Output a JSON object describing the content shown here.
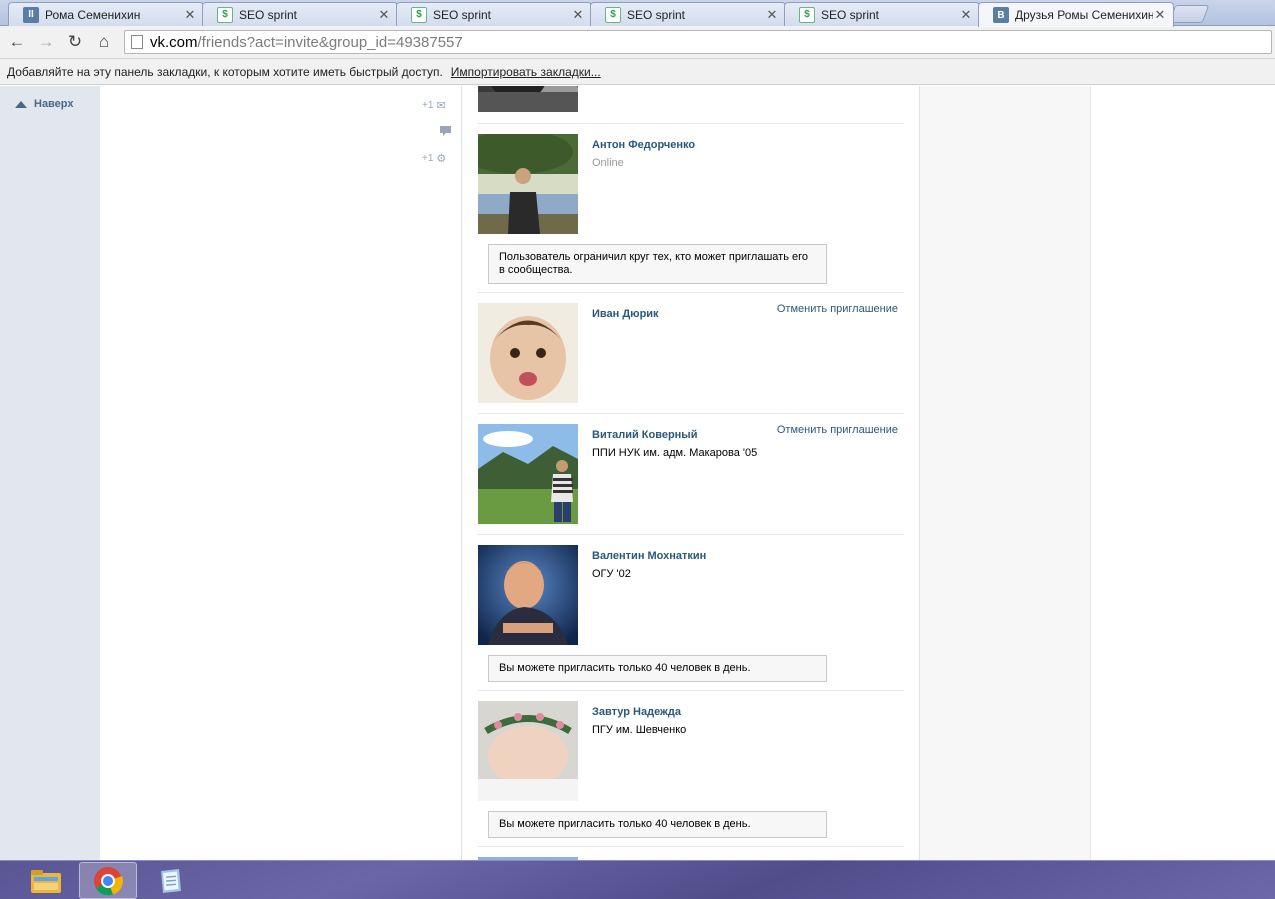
{
  "browser": {
    "tabs": [
      {
        "label": "Рома Семенихин",
        "favicon": "vk-pause-icon",
        "active": false
      },
      {
        "label": "SEO sprint",
        "favicon": "seo-sprint-icon",
        "active": false
      },
      {
        "label": "SEO sprint",
        "favicon": "seo-sprint-icon",
        "active": false
      },
      {
        "label": "SEO sprint",
        "favicon": "seo-sprint-icon",
        "active": false
      },
      {
        "label": "SEO sprint",
        "favicon": "seo-sprint-icon",
        "active": false
      },
      {
        "label": "Друзья Ромы Семенихина",
        "favicon": "vk-icon",
        "active": true
      }
    ],
    "close_glyph": "✕",
    "nav": {
      "back": "←",
      "forward": "→",
      "reload": "↻",
      "home": "⌂"
    },
    "url_host": "vk.com",
    "url_path": "/friends?act=invite&group_id=49387557",
    "bookmarks_hint": "Добавляйте на эту панель закладки, к которым хотите иметь быстрый доступ.",
    "bookmarks_import": "Импортировать закладки..."
  },
  "sidebar": {
    "to_top_label": "Наверх",
    "actions": [
      {
        "count": "+1",
        "icon": "mail-icon"
      },
      {
        "count": "",
        "icon": "comment-icon"
      },
      {
        "count": "+1",
        "icon": "gear-icon"
      }
    ]
  },
  "friends": [
    {
      "name": "",
      "sub": "",
      "online": false,
      "cancel": "",
      "notice": "",
      "avatar": "dark-photo"
    },
    {
      "name": "Антон Федорченко",
      "sub": "Online",
      "online": true,
      "cancel": "",
      "notice": "Пользователь ограничил круг тех, кто может приглашать его в сообщества.",
      "avatar": "man-under-tree"
    },
    {
      "name": "Иван Дюрик",
      "sub": "",
      "online": false,
      "cancel": "Отменить приглашение",
      "notice": "",
      "avatar": "baby-face"
    },
    {
      "name": "Виталий Коверный",
      "sub": "ППИ НУК им. адм. Макарова '05",
      "online": false,
      "cancel": "Отменить приглашение",
      "notice": "",
      "avatar": "man-mountains"
    },
    {
      "name": "Валентин Мохнаткин",
      "sub": "ОГУ '02",
      "online": false,
      "cancel": "",
      "notice": "Вы можете пригласить только 40 человек в день.",
      "avatar": "man-portrait"
    },
    {
      "name": "Завтур Надежда",
      "sub": "ПГУ им. Шевченко",
      "online": false,
      "cancel": "",
      "notice": "Вы можете пригласить только 40 человек в день.",
      "avatar": "sleeping-baby"
    }
  ],
  "taskbar": {
    "apps": [
      {
        "name": "file-explorer-icon",
        "active": false
      },
      {
        "name": "chrome-icon",
        "active": true
      },
      {
        "name": "notepad-icon",
        "active": false
      }
    ]
  }
}
